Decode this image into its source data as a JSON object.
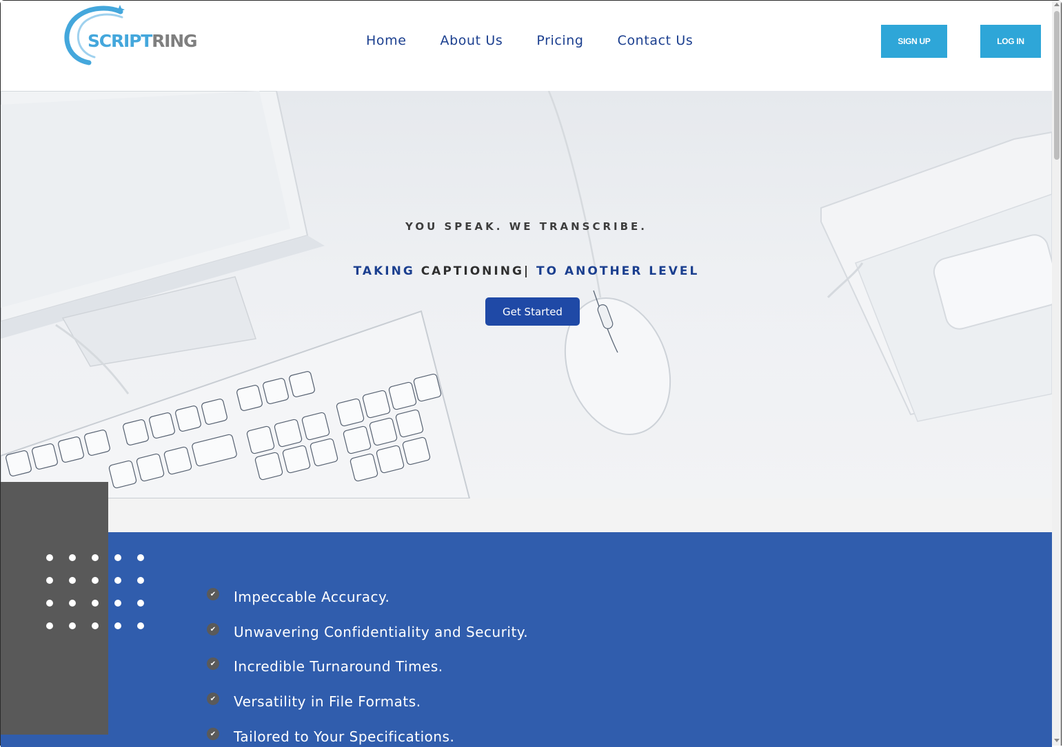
{
  "header": {
    "logo": {
      "part1": "SCRIPT",
      "part2": "RING"
    },
    "nav": [
      {
        "label": "Home"
      },
      {
        "label": "About Us"
      },
      {
        "label": "Pricing"
      },
      {
        "label": "Contact Us"
      }
    ],
    "signup_label": "SIGN UP",
    "login_label": "LOG IN"
  },
  "hero": {
    "tagline": "YOU SPEAK. WE TRANSCRIBE.",
    "headline_prefix": "TAKING",
    "headline_rotating": "CAPTIONING",
    "headline_suffix": "TO ANOTHER LEVEL",
    "cta_label": "Get Started"
  },
  "features": {
    "items": [
      "Impeccable Accuracy.",
      "Unwavering Confidentiality and Security.",
      "Incredible Turnaround Times.",
      "Versatility in File Formats.",
      "Tailored to Your Specifications."
    ]
  },
  "colors": {
    "brand_blue": "#1b3f8f",
    "accent_cyan": "#2ea6d8",
    "section_blue": "#305dad",
    "block_gray": "#595959"
  },
  "icons": {
    "check": "check-circle-icon",
    "logo_arc": "logo-arc-icon",
    "logo_star": "sparkle-icon"
  }
}
